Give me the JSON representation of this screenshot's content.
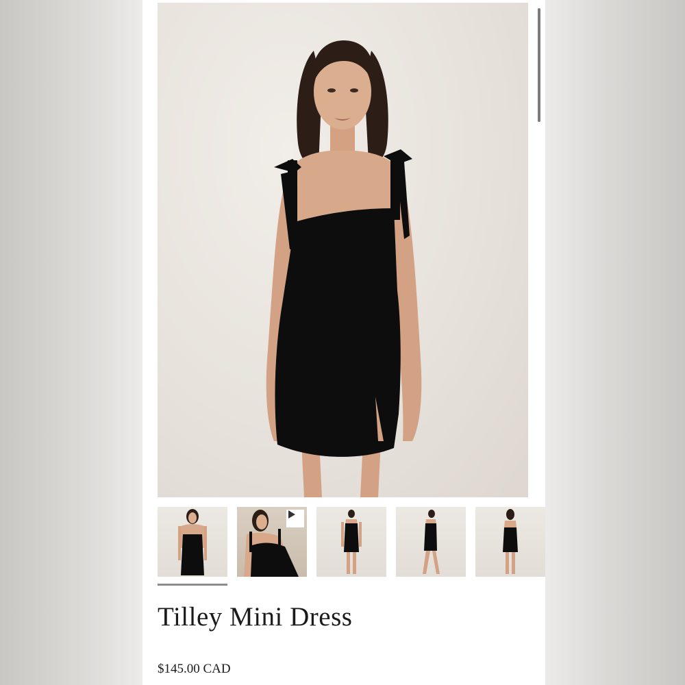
{
  "product": {
    "title": "Tilley Mini Dress",
    "price": "$145.00 CAD"
  },
  "gallery": {
    "main_image": "model-black-mini-dress-front",
    "thumbnails": [
      {
        "view": "front-closeup",
        "active": true
      },
      {
        "view": "seated-lifestyle",
        "active": false,
        "has_video": true,
        "icon": "play-icon"
      },
      {
        "view": "full-front",
        "active": false
      },
      {
        "view": "full-side-walking",
        "active": false
      },
      {
        "view": "full-back",
        "active": false
      }
    ]
  },
  "colors": {
    "dress": "#0d0d0d",
    "background_wall": "#e7e2dc",
    "skin": "#d8a88a",
    "hair": "#2c1d16",
    "active_indicator": "#8c8c8c"
  }
}
